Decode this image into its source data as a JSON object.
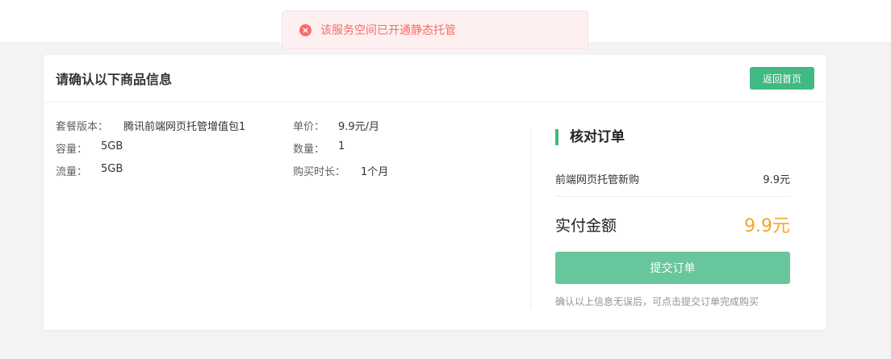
{
  "toast": {
    "icon": "error-circle-icon",
    "message": "该服务空间已开通静态托管",
    "color": "#f56c6c"
  },
  "header": {
    "title": "请确认以下商品信息",
    "home_button_label": "返回首页"
  },
  "product": {
    "left": [
      {
        "label": "套餐版本：",
        "value": "腾讯前端网页托管增值包1"
      },
      {
        "label": "容量：",
        "value": "5GB"
      },
      {
        "label": "流量：",
        "value": "5GB"
      }
    ],
    "right": [
      {
        "label": "单价：",
        "value": "9.9元/月"
      },
      {
        "label": "数量：",
        "value": "1"
      },
      {
        "label": "购买时长：",
        "value": "1个月"
      }
    ]
  },
  "summary": {
    "title": "核对订单",
    "item_name": "前端网页托管新购",
    "item_price": "9.9元",
    "total_label": "实付金额",
    "total_value": "9.9元",
    "submit_label": "提交订单",
    "hint": "确认以上信息无误后，可点击提交订单完成购买"
  },
  "colors": {
    "accent": "#42b983",
    "price": "#f5a623",
    "submit": "#67c69c"
  }
}
